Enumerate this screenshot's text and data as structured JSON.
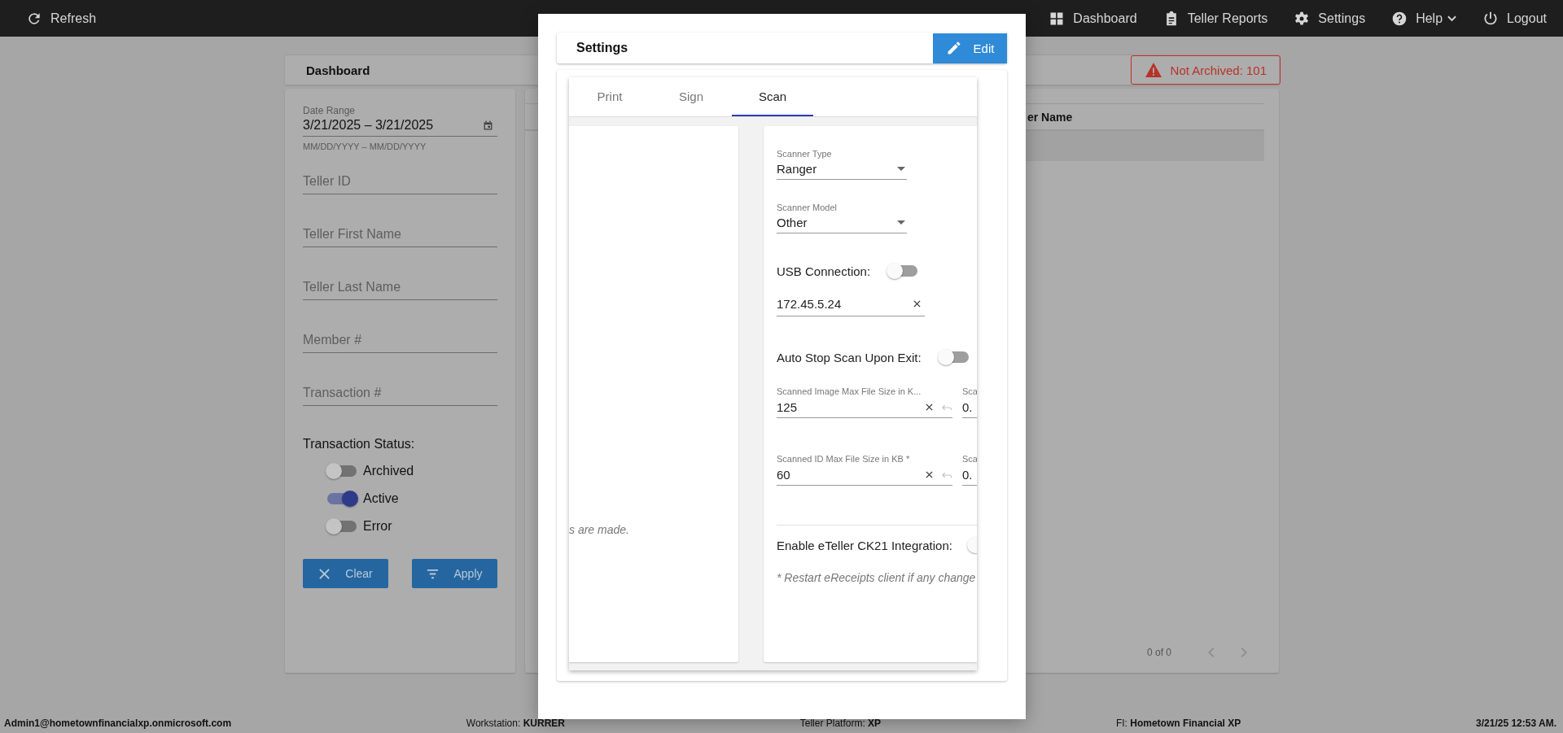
{
  "top_bar": {
    "refresh": "Refresh",
    "nav": [
      {
        "label": "Dashboard",
        "dropdown": false
      },
      {
        "label": "Teller Reports",
        "dropdown": false
      },
      {
        "label": "Settings",
        "dropdown": false
      },
      {
        "label": "Help",
        "dropdown": true
      },
      {
        "label": "Logout",
        "dropdown": false
      }
    ]
  },
  "dashboard": {
    "title": "Dashboard",
    "alert": "Not Archived: 101"
  },
  "filters": {
    "date_range": {
      "label": "Date Range",
      "value": "3/21/2025 – 3/21/2025",
      "hint": "MM/DD/YYYY – MM/DD/YYYY"
    },
    "fields": [
      {
        "placeholder": "Teller ID"
      },
      {
        "placeholder": "Teller First Name"
      },
      {
        "placeholder": "Teller Last Name"
      },
      {
        "placeholder": "Member #"
      },
      {
        "placeholder": "Transaction #"
      }
    ],
    "status_label": "Transaction Status:",
    "statuses": [
      {
        "label": "Archived",
        "on": false
      },
      {
        "label": "Active",
        "on": true
      },
      {
        "label": "Error",
        "on": false
      }
    ],
    "buttons": [
      {
        "label": "Clear",
        "kind": "clear"
      },
      {
        "label": "Apply",
        "kind": "apply"
      }
    ]
  },
  "table": {
    "columns": [
      "er Name"
    ],
    "pagination": "0 of 0"
  },
  "settings_dialog": {
    "title": "Settings",
    "edit_button": "Edit",
    "tabs": [
      {
        "label": "Print",
        "selected": false
      },
      {
        "label": "Sign",
        "selected": false
      },
      {
        "label": "Scan",
        "selected": true
      }
    ],
    "left_panel": {
      "note": "s are made."
    },
    "scan": {
      "scanner_type": {
        "label": "Scanner Type",
        "value": "Ranger"
      },
      "scanner_model": {
        "label": "Scanner Model",
        "value": "Other"
      },
      "usb_connection": {
        "label": "USB Connection:",
        "on": false
      },
      "address": {
        "value": "172.45.5.24"
      },
      "auto_stop": {
        "label": "Auto Stop Scan Upon Exit:",
        "on": false
      },
      "size_fields": [
        {
          "label": "Scanned Image Max File Size in K...",
          "value": "125",
          "side_label": "Sca",
          "side_value": "0."
        },
        {
          "label": "Scanned ID Max File Size in KB *",
          "value": "60",
          "side_label": "Sca",
          "side_value": "0."
        }
      ],
      "ck21": {
        "label": "Enable eTeller CK21 Integration:",
        "on": false
      },
      "note": "* Restart eReceipts client if any change"
    }
  },
  "status_bar": {
    "user": "Admin1@hometownfinancialxp.onmicrosoft.com",
    "workstation": "Workstation: **KURRER**",
    "platform": "Teller Platform: **XP**",
    "fi": "FI: **Hometown Financial XP**",
    "datetime": "3/21/25 12:53 AM."
  }
}
